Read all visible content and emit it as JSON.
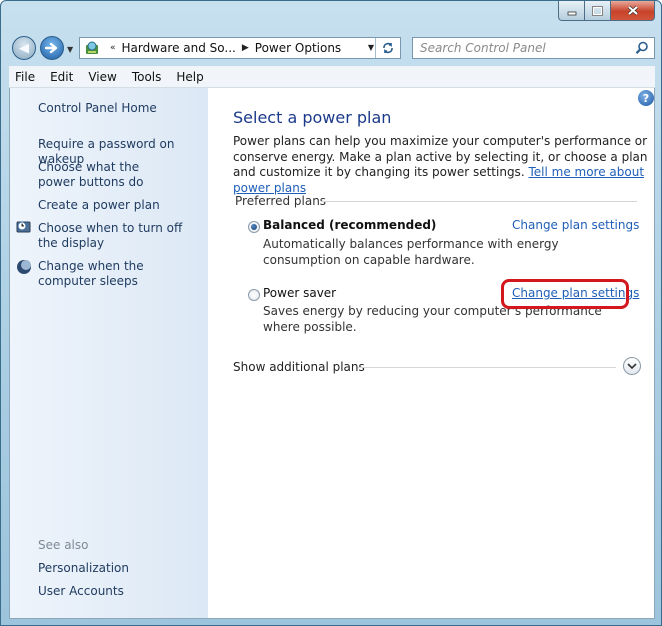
{
  "address_bar": {
    "breadcrumb_1": "Hardware and So...",
    "breadcrumb_2": "Power Options"
  },
  "search": {
    "placeholder": "Search Control Panel"
  },
  "menu": [
    "File",
    "Edit",
    "View",
    "Tools",
    "Help"
  ],
  "left_pane": {
    "home": "Control Panel Home",
    "tasks": [
      "Require a password on wakeup",
      "Choose what the power buttons do",
      "Create a power plan",
      "Choose when to turn off the display",
      "Change when the computer sleeps"
    ],
    "see_also": "See also",
    "see_also_links": [
      "Personalization",
      "User Accounts"
    ]
  },
  "main": {
    "title": "Select a power plan",
    "intro": "Power plans can help you maximize your computer's performance or conserve energy. Make a plan active by selecting it, or choose a plan and customize it by changing its power settings.",
    "intro_link": "Tell me more about power plans",
    "group_heading": "Preferred plans",
    "plans": [
      {
        "name": "Balanced (recommended)",
        "description": "Automatically balances performance with energy consumption on capable hardware.",
        "change_link": "Change plan settings",
        "selected": true
      },
      {
        "name": "Power saver",
        "description": "Saves energy by reducing your computer's performance where possible.",
        "change_link": "Change plan settings",
        "selected": false
      }
    ],
    "show_additional": "Show additional plans"
  },
  "colors": {
    "title_blue": "#1b3a8a",
    "link_blue": "#1f5fb8",
    "highlight_red": "#d4171c"
  }
}
